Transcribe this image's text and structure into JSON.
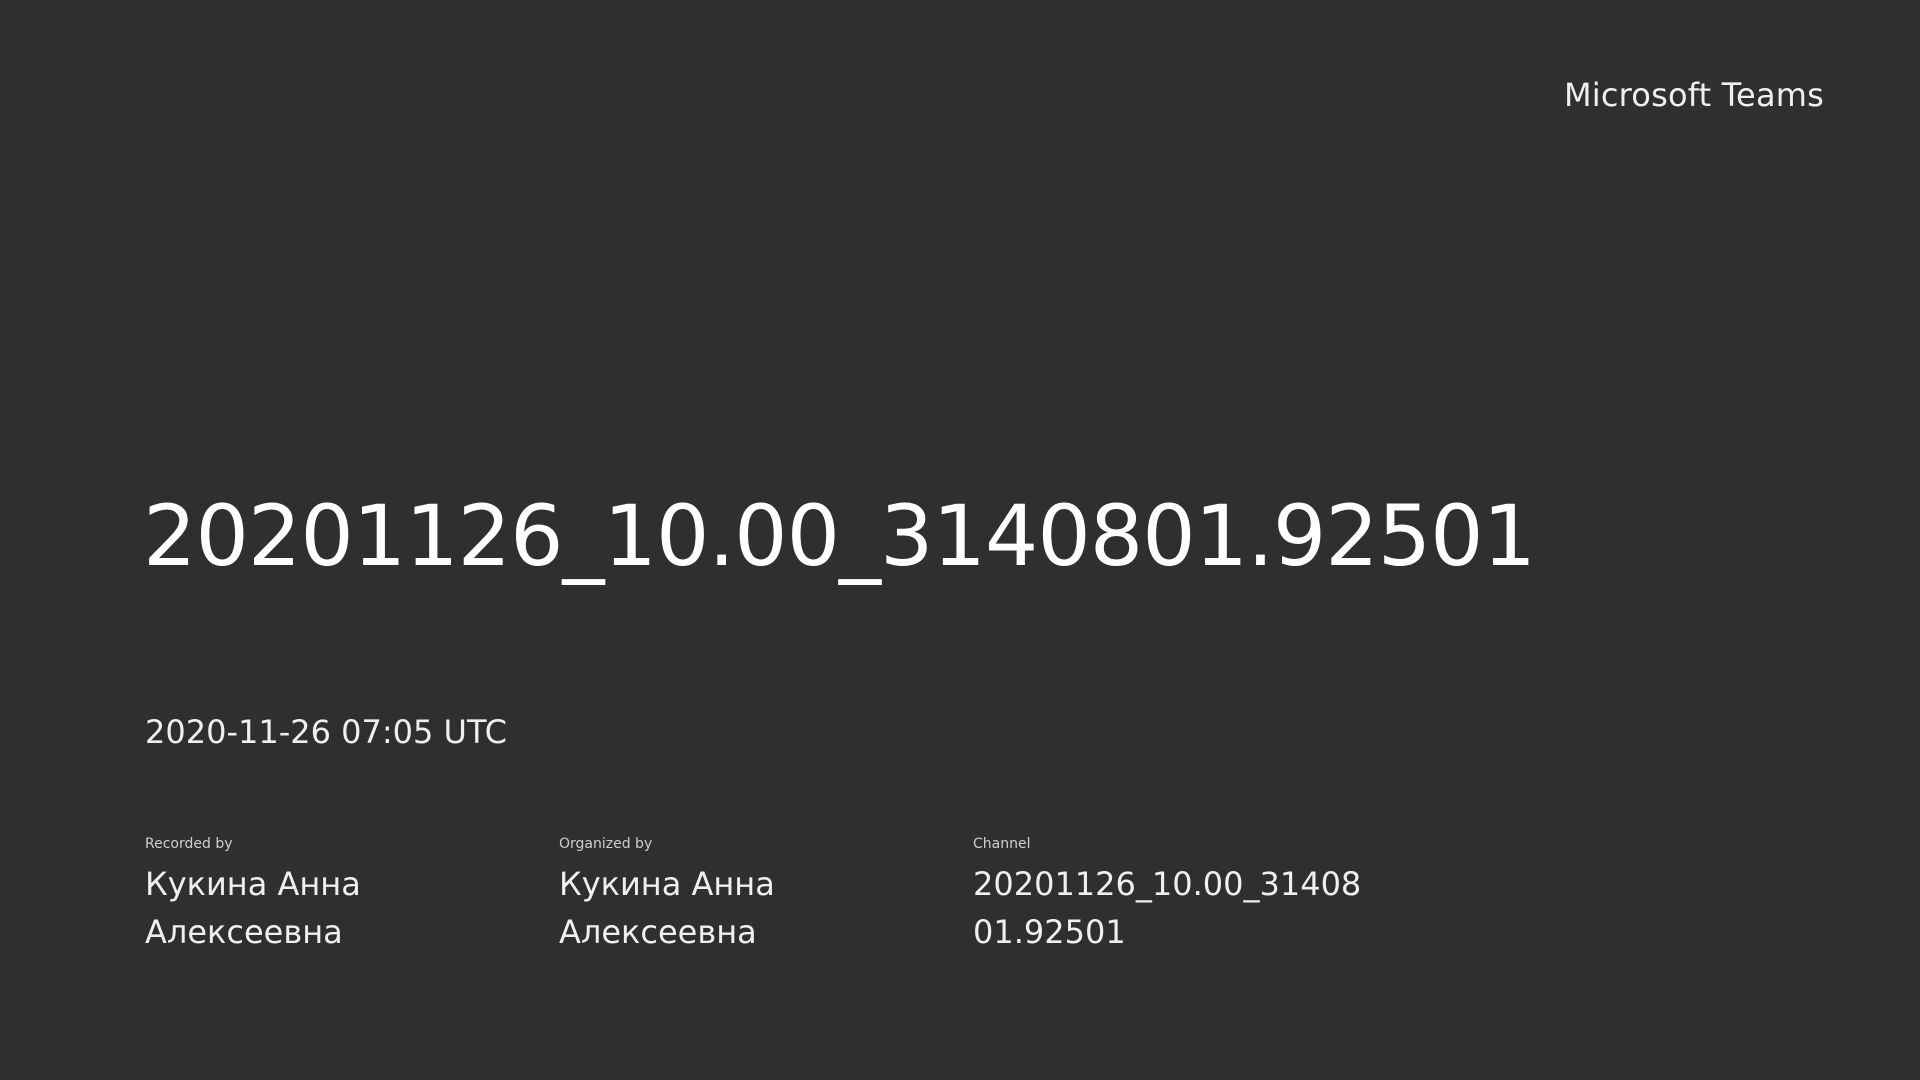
{
  "brand": "Microsoft Teams",
  "title": "20201126_10.00_3140801.92501",
  "datetime": "2020-11-26 07:05 UTC",
  "meta": {
    "recorded_by": {
      "label": "Recorded by",
      "value": "Кукина Анна Алексеевна"
    },
    "organized_by": {
      "label": "Organized by",
      "value": "Кукина Анна Алексеевна"
    },
    "channel": {
      "label": "Channel",
      "value": "20201126_10.00_3140801.92501"
    }
  },
  "colors": {
    "background": "#2f2f2f",
    "text": "#efefef"
  }
}
